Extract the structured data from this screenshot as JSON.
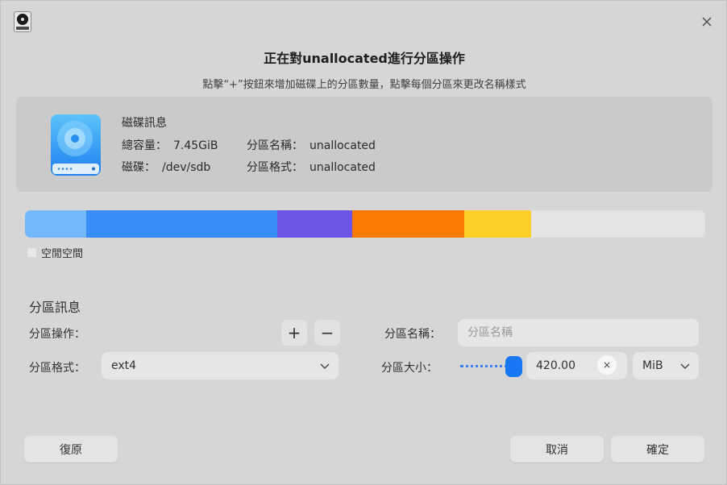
{
  "dialog": {
    "title": "正在對unallocated進行分區操作",
    "subtitle": "點擊“+”按鈕來增加磁碟上的分區數量，點擊每個分區來更改名稱樣式"
  },
  "disk_info": {
    "heading": "磁碟訊息",
    "capacity_label": "總容量：",
    "capacity_value": "7.45GiB",
    "disk_label": "磁碟：",
    "disk_value": "/dev/sdb",
    "partition_name_label": "分區名稱：",
    "partition_name_value": "unallocated",
    "partition_format_label": "分區格式：",
    "partition_format_value": "unallocated"
  },
  "partition_bar": {
    "segments": [
      {
        "color": "#73b8fb",
        "fraction": 0.0895
      },
      {
        "color": "#3a8cf8",
        "fraction": 0.2815
      },
      {
        "color": "#6c55e4",
        "fraction": 0.1095
      },
      {
        "color": "#fb7a04",
        "fraction": 0.165
      },
      {
        "color": "#fecf26",
        "fraction": 0.0985
      },
      {
        "color": "#e3e3e3",
        "fraction": 0.256
      }
    ]
  },
  "legend": {
    "free_space_label": "空閒空間",
    "free_space_color": "#e8e8e8"
  },
  "partition_info": {
    "section_title": "分區訊息",
    "operation_label": "分區操作：",
    "add_symbol": "+",
    "remove_symbol": "−",
    "name_label": "分區名稱：",
    "name_placeholder": "分區名稱",
    "format_label": "分區格式：",
    "format_value": "ext4",
    "size_label": "分區大小：",
    "size_value": "420.00",
    "size_slider_fraction": 1.0,
    "clear_symbol": "×",
    "unit_value": "MiB"
  },
  "buttons": {
    "revert": "復原",
    "cancel": "取消",
    "confirm": "確定"
  },
  "icons": {
    "app": "disk-utility-icon",
    "close": "close-icon",
    "disk": "hard-disk-icon",
    "dropdown": "chevron-down-icon"
  },
  "colors": {
    "accent": "#1877f2"
  }
}
